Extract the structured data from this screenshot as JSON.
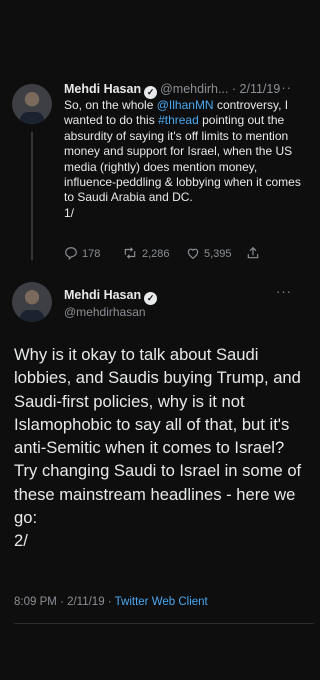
{
  "tweet1": {
    "name": "Mehdi Hasan",
    "handle": "@mehdirh...",
    "sep": "·",
    "date": "2/11/19",
    "more": "···",
    "text_before_mention": "So, on the whole ",
    "mention": "@IlhanMN",
    "text_after_mention": " controversy, I wanted to do this ",
    "hashtag": "#thread",
    "text_after_hashtag": " pointing out the absurdity of saying it's off limits to mention money and support for Israel, when the US media (rightly) does mention money, influence-peddling & lobbying when it comes to Saudi Arabia and DC.",
    "thread_marker": "1/",
    "replies": "178",
    "retweets": "2,286",
    "likes": "5,395"
  },
  "tweet2": {
    "name": "Mehdi Hasan",
    "handle": "@mehdirhasan",
    "more": "···",
    "text": "Why is it okay to talk about Saudi lobbies, and Saudis buying Trump, and Saudi-first policies, why is it not Islamophobic to say all of that, but it's anti-Semitic when it comes to Israel? Try changing Saudi to Israel in some of these mainstream headlines - here we go:",
    "thread_marker": "2/",
    "time": "8:09 PM",
    "date": "2/11/19",
    "sep": "·",
    "client": "Twitter Web Client"
  },
  "colors": {
    "background": "#0e0e0e",
    "link": "#4ba7f0",
    "muted": "#8b8f94"
  }
}
